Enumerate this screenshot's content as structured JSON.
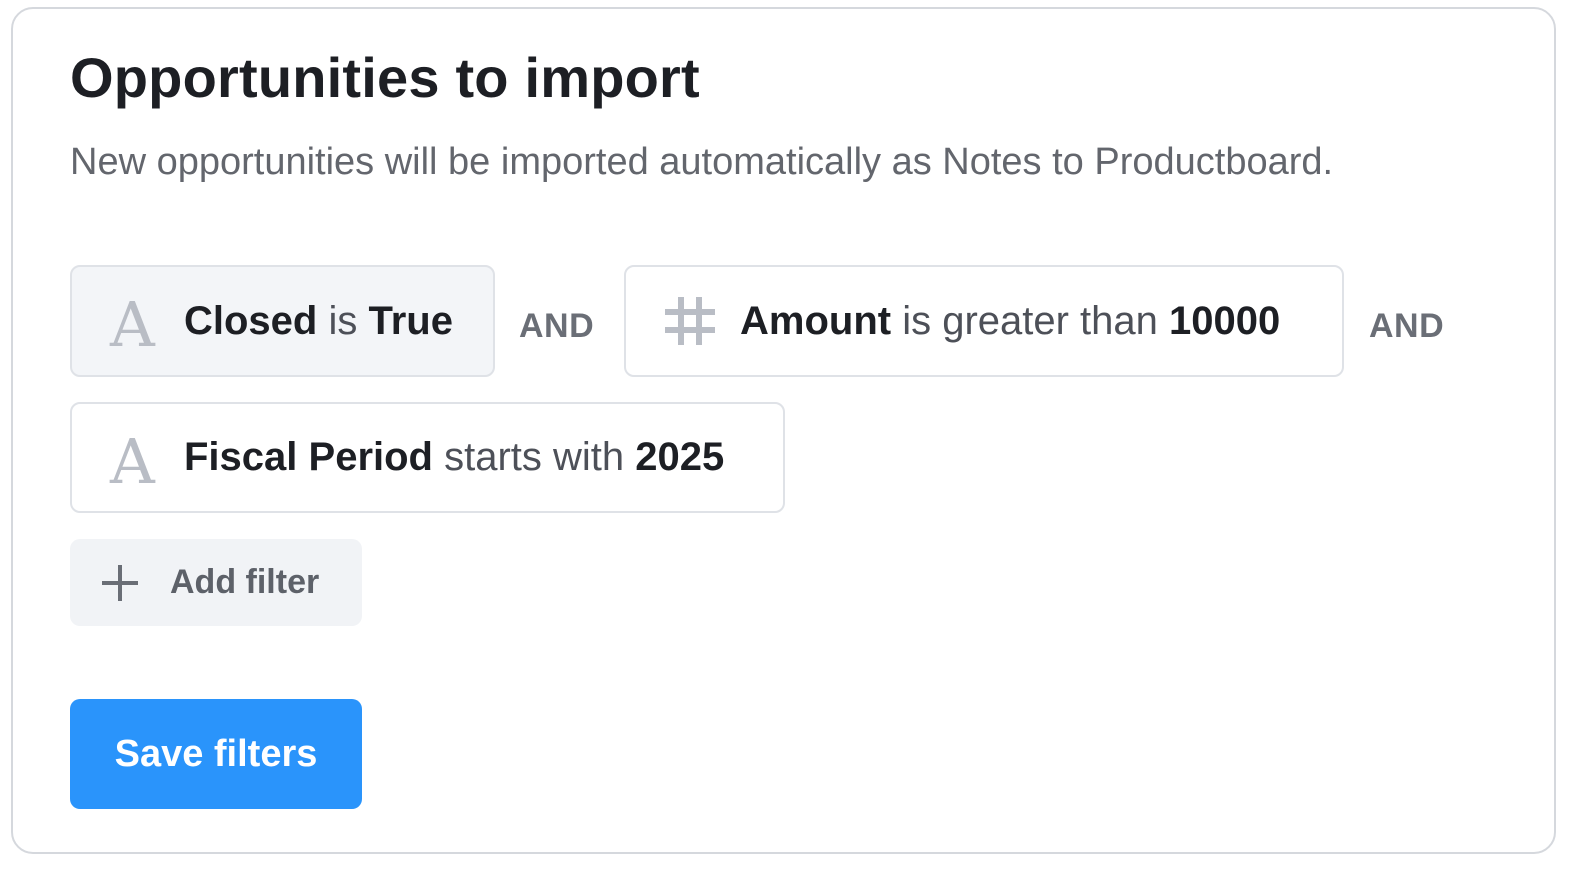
{
  "header": {
    "title": "Opportunities to import",
    "subtitle": "New opportunities will be imported automatically as Notes to Productboard."
  },
  "filters": [
    {
      "icon": "text-type-icon",
      "field": "Closed",
      "operator": "is",
      "value": "True",
      "active": true
    },
    {
      "icon": "number-type-icon",
      "field": "Amount",
      "operator": "is greater than",
      "value": "10000",
      "active": false
    },
    {
      "icon": "text-type-icon",
      "field": "Fiscal Period",
      "operator": "starts with",
      "value": "2025",
      "active": false
    }
  ],
  "connectors": [
    "AND",
    "AND"
  ],
  "icons": {
    "text_glyph": "A"
  },
  "add_filter": {
    "label": "Add filter",
    "icon": "plus-icon"
  },
  "save": {
    "label": "Save filters"
  },
  "colors": {
    "primary_button": "#2a94fb",
    "active_chip_bg": "#f3f5f8",
    "chip_border": "#dfe2e7",
    "icon_gray": "#b9bdc5"
  }
}
